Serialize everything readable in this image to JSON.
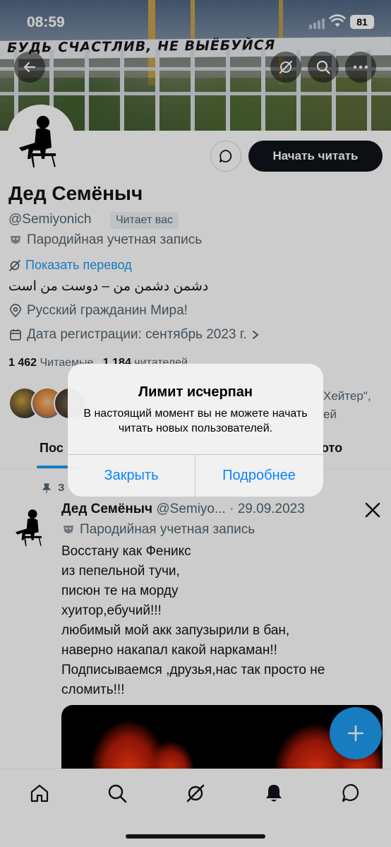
{
  "status_bar": {
    "time": "08:59",
    "battery": "81"
  },
  "banner": {
    "graffiti": "БУДЬ СЧАСТЛИВ, НЕ ВЫЁБУЙСЯ"
  },
  "profile": {
    "follow_button": "Начать читать",
    "name": "Дед Семёныч",
    "handle": "@Semiyonich",
    "follows_you": "Читает вас",
    "parody_label": "Пародийная учетная запись",
    "translate_link": "Показать перевод",
    "bio": "دشمن دشمن من – دوست من است",
    "location": "Русский гражданин Мира!",
    "joined": "Дата регистрации: сентябрь 2023 г.",
    "following_count": "1 462",
    "following_label": "Читаемые",
    "followers_count": "1 184",
    "followers_label": "читателей",
    "followed_by_line1": "Хейтер\",",
    "followed_by_line2": "ей"
  },
  "tabs": {
    "posts": "Пос",
    "media": "ото"
  },
  "alert": {
    "title": "Лимит исчерпан",
    "message": "В настоящий момент вы не можете начать читать новых пользователей.",
    "close": "Закрыть",
    "more": "Подробнее"
  },
  "tweet": {
    "pinned_label": "З",
    "author": "Дед Семёныч",
    "meta": "@Semiyo... · 29.09.2023",
    "parody_label": "Пародийная учетная запись",
    "lines": [
      "Восстану как Феникс",
      "из пепельной тучи,",
      "писюн те на морду",
      "хуитор,ебучий!!!",
      "любимый мой акк запузырили в бан,",
      "наверно накапал какой наркаман!!",
      "Подписываемся ,друзья,нас так просто не",
      "сломить!!!"
    ]
  },
  "icons": {
    "back": "back-arrow-icon",
    "grok": "grok-icon",
    "search": "search-icon",
    "more": "more-icon",
    "message": "message-icon",
    "parody": "parody-mask-icon",
    "translate": "translate-icon",
    "location": "location-pin-icon",
    "calendar": "calendar-icon",
    "pin": "pin-icon",
    "x_logo": "x-logo-icon",
    "compose": "plus-icon"
  },
  "colors": {
    "accent": "#1d9bf0",
    "text": "#0f1419",
    "secondary": "#536471",
    "alert_button": "#0a84ff"
  }
}
